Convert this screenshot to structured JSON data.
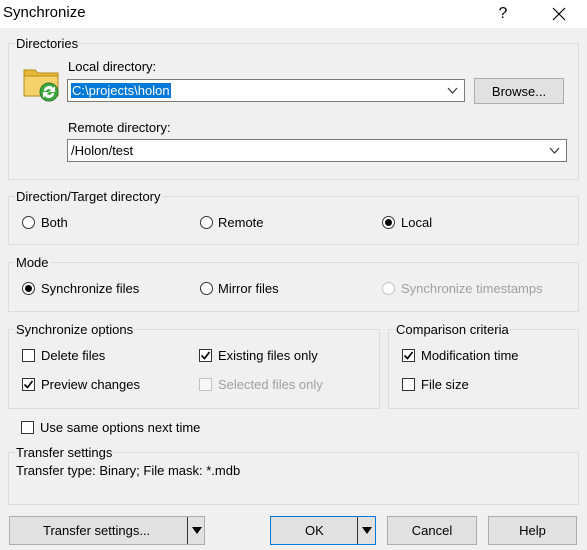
{
  "window": {
    "title": "Synchronize",
    "help_glyph": "?",
    "close_glyph": "✕"
  },
  "directories": {
    "group_label": "Directories",
    "local_label": "Local directory:",
    "local_value": "C:\\projects\\holon",
    "browse_label": "Browse...",
    "remote_label": "Remote directory:",
    "remote_value": "/Holon/test",
    "icon": "folder-sync-icon"
  },
  "direction": {
    "group_label": "Direction/Target directory",
    "options": [
      {
        "label": "Both",
        "checked": false
      },
      {
        "label": "Remote",
        "checked": false
      },
      {
        "label": "Local",
        "checked": true
      }
    ]
  },
  "mode": {
    "group_label": "Mode",
    "options": [
      {
        "label": "Synchronize files",
        "checked": true,
        "enabled": true
      },
      {
        "label": "Mirror files",
        "checked": false,
        "enabled": true
      },
      {
        "label": "Synchronize timestamps",
        "checked": false,
        "enabled": false
      }
    ]
  },
  "sync_options": {
    "group_label": "Synchronize options",
    "items": [
      {
        "label": "Delete files",
        "checked": false,
        "enabled": true
      },
      {
        "label": "Existing files only",
        "checked": true,
        "enabled": true
      },
      {
        "label": "Preview changes",
        "checked": true,
        "enabled": true
      },
      {
        "label": "Selected files only",
        "checked": false,
        "enabled": false
      }
    ]
  },
  "comparison": {
    "group_label": "Comparison criteria",
    "items": [
      {
        "label": "Modification time",
        "checked": true
      },
      {
        "label": "File size",
        "checked": false
      }
    ]
  },
  "same_options": {
    "label": "Use same options next time",
    "checked": false
  },
  "transfer": {
    "group_label": "Transfer settings",
    "summary": "Transfer type: Binary; File mask: *.mdb"
  },
  "buttons": {
    "transfer_settings": "Transfer settings...",
    "ok": "OK",
    "cancel": "Cancel",
    "help": "Help"
  },
  "colors": {
    "accent": "#0078d7",
    "window_bg": "#f0f0f0",
    "check_mark": "#000000"
  }
}
